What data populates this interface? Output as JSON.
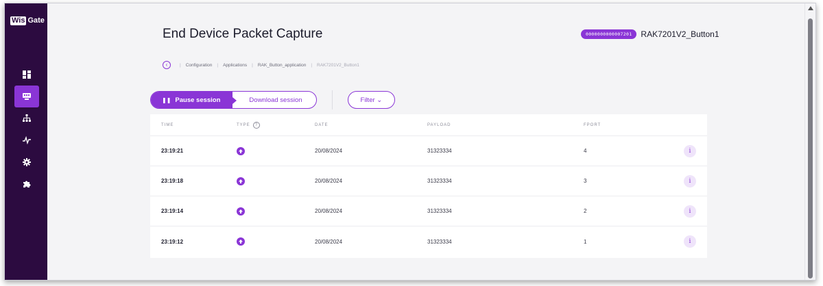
{
  "app": {
    "logo_prefix": "Wis",
    "logo_suffix": "Gate"
  },
  "sidebar": {
    "items": [
      {
        "name": "dashboard",
        "icon": "dashboard-icon",
        "active": false
      },
      {
        "name": "applications",
        "icon": "device-icon",
        "active": true
      },
      {
        "name": "gateways",
        "icon": "network-icon",
        "active": false
      },
      {
        "name": "activity",
        "icon": "pulse-icon",
        "active": false
      },
      {
        "name": "settings",
        "icon": "gear-icon",
        "active": false
      },
      {
        "name": "extensions",
        "icon": "puzzle-icon",
        "active": false
      }
    ]
  },
  "header": {
    "title": "End Device Packet Capture",
    "device_eui": "0000000000007201",
    "device_name": "RAK7201V2_Button1"
  },
  "breadcrumb": {
    "items": [
      "Configuration",
      "Applications",
      "RAK_Button_application"
    ],
    "current": "RAK7201V2_Button1"
  },
  "toolbar": {
    "pause_glyph": "❚❚",
    "pause_label": "Pause session",
    "download_label": "Download session",
    "filter_label": "Filter ⌄"
  },
  "table": {
    "columns": {
      "time": "TIME",
      "type": "TYPE",
      "type_help": "?",
      "date": "DATE",
      "payload": "PAYLOAD",
      "fport": "FPORT"
    },
    "rows": [
      {
        "time": "23:19:21",
        "date": "20/08/2024",
        "payload": "31323334",
        "fport": "4",
        "info": "i"
      },
      {
        "time": "23:19:18",
        "date": "20/08/2024",
        "payload": "31323334",
        "fport": "3",
        "info": "i"
      },
      {
        "time": "23:19:14",
        "date": "20/08/2024",
        "payload": "31323334",
        "fport": "2",
        "info": "i"
      },
      {
        "time": "23:19:12",
        "date": "20/08/2024",
        "payload": "31323334",
        "fport": "1",
        "info": "i"
      }
    ]
  },
  "colors": {
    "accent": "#8a35d6",
    "sidebar": "#2c0b40",
    "background": "#f4f4f6"
  }
}
